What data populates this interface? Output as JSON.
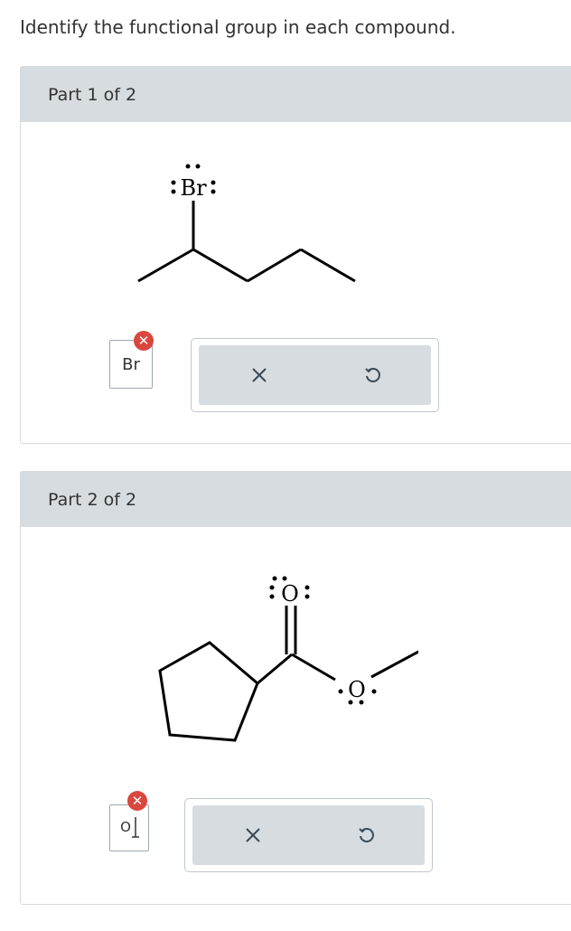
{
  "instruction": "Identify the functional group in each compound.",
  "parts": [
    {
      "label": "Part 1 of 2",
      "molecule_atom_label": "Br",
      "answer_chip_label": "Br",
      "buttons": {
        "clear": "clear-icon",
        "undo": "undo-icon"
      }
    },
    {
      "label": "Part 2 of 2",
      "molecule_atom_labels": [
        "O",
        "O"
      ],
      "answer_chip_label": "O",
      "buttons": {
        "clear": "clear-icon",
        "undo": "undo-icon"
      }
    }
  ],
  "colors": {
    "header": "#d6dcdf",
    "remove_badge": "#d9473f",
    "border": "#d9d9d9"
  }
}
